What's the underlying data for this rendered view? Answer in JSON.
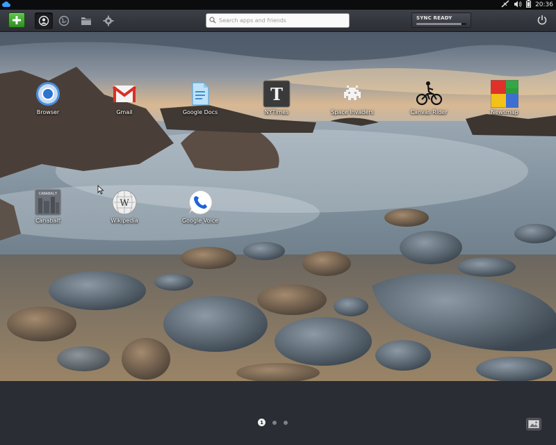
{
  "system_bar": {
    "clock": "20:36",
    "icons": [
      "cloud-icon",
      "network-icon",
      "volume-icon",
      "battery-icon"
    ]
  },
  "toolbar": {
    "add_icon": "plus-icon",
    "nav_icons": [
      "apps-icon",
      "globe-icon",
      "folder-icon",
      "gear-icon"
    ],
    "search": {
      "placeholder": "Search apps and friends",
      "value": ""
    },
    "sync": {
      "label": "SYNC READY",
      "progress": 0.9
    },
    "power_icon": "power-icon"
  },
  "apps": [
    {
      "label": "Browser",
      "icon": "chrome-icon"
    },
    {
      "label": "Gmail",
      "icon": "gmail-icon"
    },
    {
      "label": "Google Docs",
      "icon": "docs-icon"
    },
    {
      "label": "NYTimes",
      "icon": "nytimes-icon"
    },
    {
      "label": "Space Invaders",
      "icon": "invader-icon"
    },
    {
      "label": "Canvas Rider",
      "icon": "bike-icon"
    },
    {
      "label": "Newsmap",
      "icon": "newsmap-icon"
    },
    {
      "label": "Canabalt",
      "icon": "canabalt-icon",
      "icon_text": "CANABALT"
    },
    {
      "label": "Wikipedia",
      "icon": "wikipedia-icon"
    },
    {
      "label": "Google Voice",
      "icon": "voice-icon"
    }
  ],
  "pager": {
    "current": "1",
    "pages": 3
  },
  "dock": {
    "wallpaper_icon": "image-icon"
  },
  "colors": {
    "accent_green": "#3fa52e",
    "toolbar": "#33363c",
    "dock": "#2b2d34"
  }
}
